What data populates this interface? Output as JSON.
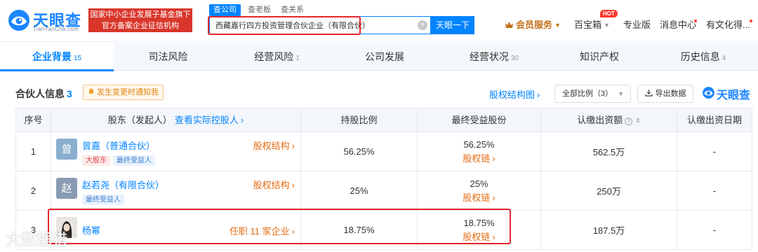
{
  "header": {
    "logo_cn": "天眼查",
    "logo_en": "TianYanCha.com",
    "banner_line1": "国家中小企业发展子基金旗下",
    "banner_line2": "官方备案企业征信机构",
    "search_tabs": [
      "查公司",
      "查老板",
      "查关系"
    ],
    "search_value": "西藏嘉行四方投资管理合伙企业（有限合伙）",
    "search_button": "天眼一下",
    "nav": {
      "member": "会员服务",
      "treasure": "百宝箱",
      "hot": "HOT",
      "pro": "专业版",
      "messages": "消息中心",
      "user": "有文化得..."
    }
  },
  "tabs": [
    {
      "label": "企业背景",
      "count": "15"
    },
    {
      "label": "司法风险",
      "count": ""
    },
    {
      "label": "经营风险",
      "count": "1"
    },
    {
      "label": "公司发展",
      "count": ""
    },
    {
      "label": "经营状况",
      "count": "30"
    },
    {
      "label": "知识产权",
      "count": ""
    },
    {
      "label": "历史信息",
      "count": "4"
    }
  ],
  "section": {
    "title": "合伙人信息",
    "count": "3",
    "notify": "发生变更时通知我",
    "equity_chart": "股权结构图",
    "ratio_select": "全部比例（3）",
    "export": "导出数据",
    "watermark": "天眼查"
  },
  "table": {
    "headers": {
      "index": "序号",
      "shareholder": "股东（发起人）",
      "controller_link": "查看实际控股人",
      "ratio": "持股比例",
      "final": "最终受益股份",
      "capital": "认缴出资额",
      "date": "认缴出资日期"
    },
    "rows": [
      {
        "index": "1",
        "avatar": "曾",
        "name": "曾嘉（普通合伙）",
        "tags": [
          "大股东",
          "最终受益人"
        ],
        "side_link": "股权结构",
        "ratio": "56.25%",
        "final": "56.25%",
        "final_link": "股权链",
        "capital": "562.5万",
        "date": "-"
      },
      {
        "index": "2",
        "avatar": "赵",
        "name": "赵若尧（有限合伙）",
        "tags": [
          "最终受益人"
        ],
        "side_link": "股权结构",
        "ratio": "25%",
        "final": "25%",
        "final_link": "股权链",
        "capital": "250万",
        "date": "-"
      },
      {
        "index": "3",
        "avatar": "",
        "name": "杨幂",
        "tags": [],
        "side_link": "任职 11 家企业",
        "ratio": "18.75%",
        "final": "18.75%",
        "final_link": "股权链",
        "capital": "187.5万",
        "date": "-"
      }
    ]
  },
  "watermark_text": "大数据猎",
  "colors": {
    "brand_blue": "#0084ff",
    "highlight_red": "#e5262b",
    "link_orange": "#e46b13",
    "member_gold": "#c4701a"
  }
}
